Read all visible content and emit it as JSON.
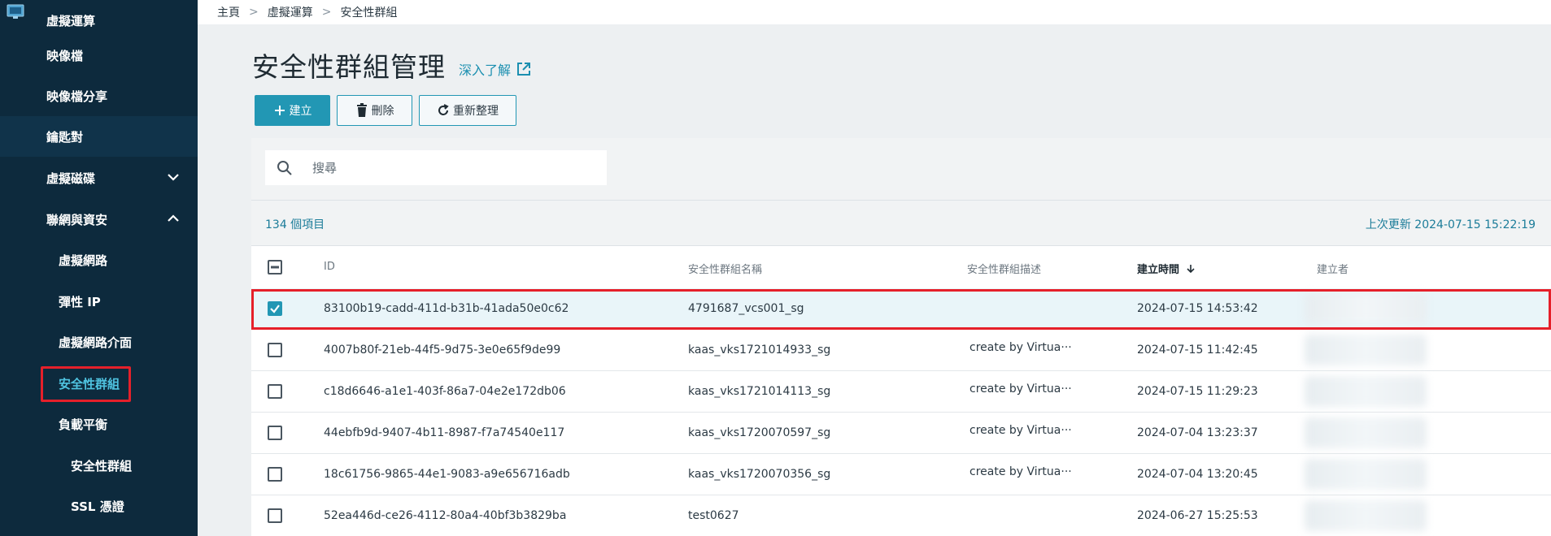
{
  "sidebar": {
    "items": [
      {
        "label": "虛擬運算"
      },
      {
        "label": "映像檔"
      },
      {
        "label": "映像檔分享"
      },
      {
        "label": "鑰匙對"
      },
      {
        "label": "虛擬磁碟"
      },
      {
        "label": "聯網與資安"
      },
      {
        "label": "虛擬網路"
      },
      {
        "label": "彈性 IP"
      },
      {
        "label": "虛擬網路介面"
      },
      {
        "label": "安全性群組"
      },
      {
        "label": "負載平衡"
      },
      {
        "label": "安全性群組"
      },
      {
        "label": "SSL 憑證"
      }
    ]
  },
  "breadcrumb": [
    "主頁",
    "虛擬運算",
    "安全性群組"
  ],
  "page": {
    "title": "安全性群組管理",
    "learn_more": "深入了解"
  },
  "toolbar": {
    "create": "建立",
    "delete": "刪除",
    "refresh": "重新整理"
  },
  "search": {
    "placeholder": "搜尋"
  },
  "table": {
    "count": "134 個項目",
    "last_updated": "上次更新 2024-07-15 15:22:19",
    "headers": [
      "ID",
      "安全性群組名稱",
      "安全性群組描述",
      "建立時間",
      "建立者"
    ],
    "rows": [
      {
        "id": "83100b19-cadd-411d-b31b-41ada50e0c62",
        "name": "4791687_vcs001_sg",
        "desc": "",
        "created": "2024-07-15 14:53:42",
        "selected": true
      },
      {
        "id": "4007b80f-21eb-44f5-9d75-3e0e65f9de99",
        "name": "kaas_vks1721014933_sg",
        "desc": "create by Virtua···",
        "created": "2024-07-15 11:42:45",
        "selected": false
      },
      {
        "id": "c18d6646-a1e1-403f-86a7-04e2e172db06",
        "name": "kaas_vks1721014113_sg",
        "desc": "create by Virtua···",
        "created": "2024-07-15 11:29:23",
        "selected": false
      },
      {
        "id": "44ebfb9d-9407-4b11-8987-f7a74540e117",
        "name": "kaas_vks1720070597_sg",
        "desc": "create by Virtua···",
        "created": "2024-07-04 13:23:37",
        "selected": false
      },
      {
        "id": "18c61756-9865-44e1-9083-a9e656716adb",
        "name": "kaas_vks1720070356_sg",
        "desc": "create by Virtua···",
        "created": "2024-07-04 13:20:45",
        "selected": false
      },
      {
        "id": "52ea446d-ce26-4112-80a4-40bf3b3829ba",
        "name": "test0627",
        "desc": "",
        "created": "2024-06-27 15:25:53",
        "selected": false
      }
    ]
  },
  "colors": {
    "sidebar_bg": "#0d2a3d",
    "accent": "#2297b4",
    "highlight_red": "#e5202a",
    "active_text": "#4fc3e0"
  }
}
